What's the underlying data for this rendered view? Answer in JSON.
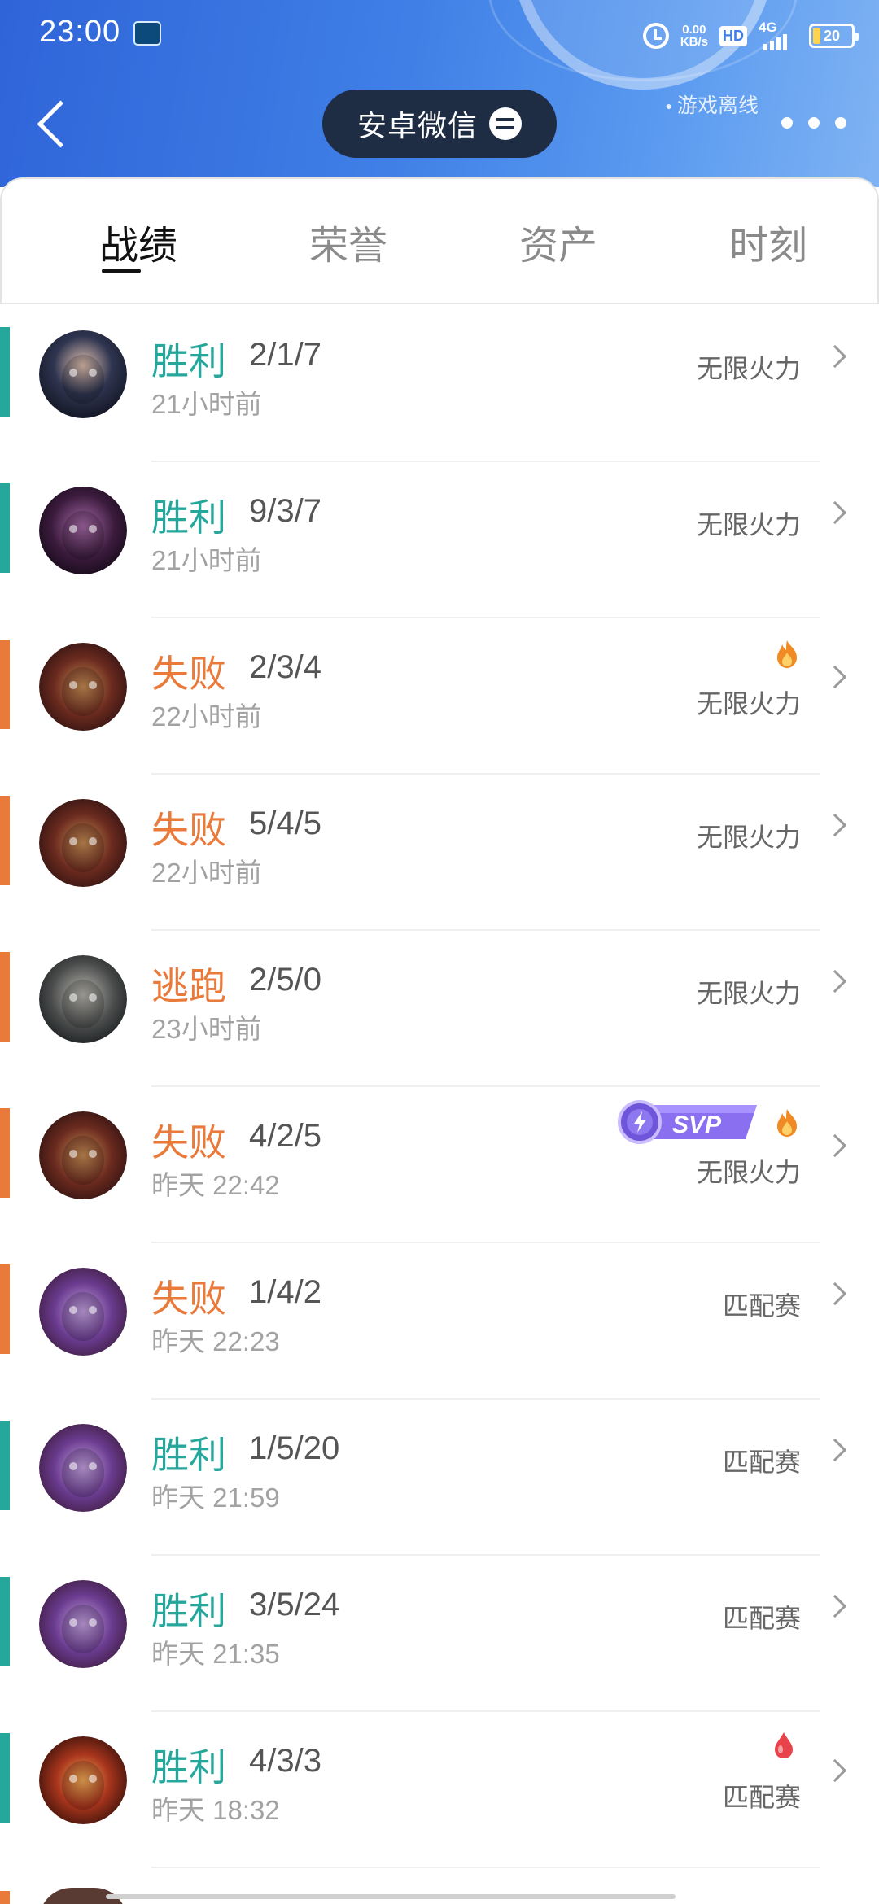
{
  "status_bar": {
    "time": "23:00",
    "speed_value": "0.00",
    "speed_unit": "KB/s",
    "hd": "HD",
    "network": "4G",
    "battery": "20"
  },
  "header": {
    "account_name": "安卓微信",
    "offline_status": "游戏离线"
  },
  "tabs": [
    {
      "label": "战绩",
      "active": true
    },
    {
      "label": "荣誉",
      "active": false
    },
    {
      "label": "资产",
      "active": false
    },
    {
      "label": "时刻",
      "active": false
    }
  ],
  "colors": {
    "win": "#25a89b",
    "loss": "#ea7a3a",
    "header_start": "#2f64d8",
    "pill": "#1f2d44"
  },
  "matches": [
    {
      "result": "胜利",
      "outcome": "win",
      "kda": "2/1/7",
      "time": "21小时前",
      "mode": "无限火力",
      "badges": [],
      "avatar": "champion-avatar-1"
    },
    {
      "result": "胜利",
      "outcome": "win",
      "kda": "9/3/7",
      "time": "21小时前",
      "mode": "无限火力",
      "badges": [],
      "avatar": "champion-avatar-2"
    },
    {
      "result": "失败",
      "outcome": "loss",
      "kda": "2/3/4",
      "time": "22小时前",
      "mode": "无限火力",
      "badges": [
        "fire-icon"
      ],
      "avatar": "champion-avatar-3"
    },
    {
      "result": "失败",
      "outcome": "loss",
      "kda": "5/4/5",
      "time": "22小时前",
      "mode": "无限火力",
      "badges": [],
      "avatar": "champion-avatar-3"
    },
    {
      "result": "逃跑",
      "outcome": "loss",
      "kda": "2/5/0",
      "time": "23小时前",
      "mode": "无限火力",
      "badges": [],
      "avatar": "champion-avatar-4"
    },
    {
      "result": "失败",
      "outcome": "loss",
      "kda": "4/2/5",
      "time": "昨天 22:42",
      "mode": "无限火力",
      "badges": [
        "svp-badge",
        "fire-icon"
      ],
      "avatar": "champion-avatar-3"
    },
    {
      "result": "失败",
      "outcome": "loss",
      "kda": "1/4/2",
      "time": "昨天 22:23",
      "mode": "匹配赛",
      "badges": [],
      "avatar": "champion-avatar-5"
    },
    {
      "result": "胜利",
      "outcome": "win",
      "kda": "1/5/20",
      "time": "昨天 21:59",
      "mode": "匹配赛",
      "badges": [],
      "avatar": "champion-avatar-5"
    },
    {
      "result": "胜利",
      "outcome": "win",
      "kda": "3/5/24",
      "time": "昨天 21:35",
      "mode": "匹配赛",
      "badges": [],
      "avatar": "champion-avatar-5"
    },
    {
      "result": "胜利",
      "outcome": "win",
      "kda": "4/3/3",
      "time": "昨天 18:32",
      "mode": "匹配赛",
      "badges": [
        "blood-drop-icon"
      ],
      "avatar": "champion-avatar-6"
    }
  ],
  "svp_badge": {
    "label": "SVP"
  }
}
